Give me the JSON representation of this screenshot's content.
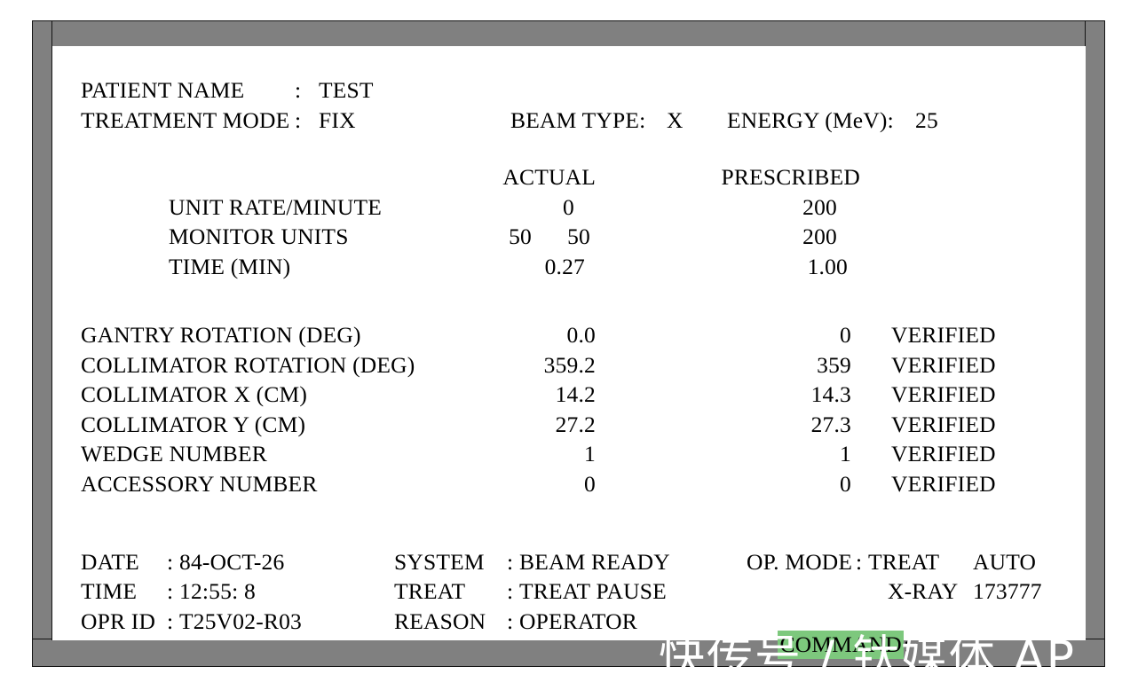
{
  "window": {
    "title_bar_label": "",
    "frame_color": "#808080",
    "frame_outline_color": "#141414",
    "screen_background": "#ffffff",
    "text_color": "#000000",
    "highlight_color": "#7dc87d"
  },
  "header": {
    "patient_name_label": "PATIENT NAME",
    "patient_name_sep": ":",
    "patient_name_value": "TEST",
    "treatment_mode_label": "TREATMENT MODE",
    "treatment_mode_sep": ":",
    "treatment_mode_value": "FIX",
    "beam_type_label": "BEAM TYPE:",
    "beam_type_value": "X",
    "energy_label": "ENERGY (MeV):",
    "energy_value": "25"
  },
  "dose_table": {
    "col_actual": "ACTUAL",
    "col_prescribed": "PRESCRIBED",
    "rows": [
      {
        "label": "UNIT RATE/MINUTE",
        "actual": "0",
        "actual2": "",
        "prescribed": "200"
      },
      {
        "label": "MONITOR UNITS",
        "actual": "50",
        "actual2": "50",
        "prescribed": "200"
      },
      {
        "label": "TIME (MIN)",
        "actual": "0.27",
        "actual2": "",
        "prescribed": "1.00"
      }
    ]
  },
  "parameter_table": {
    "rows": [
      {
        "label": "GANTRY ROTATION (DEG)",
        "actual": "0.0",
        "prescribed": "0",
        "status": "VERIFIED"
      },
      {
        "label": "COLLIMATOR ROTATION (DEG)",
        "actual": "359.2",
        "prescribed": "359",
        "status": "VERIFIED"
      },
      {
        "label": "COLLIMATOR X (CM)",
        "actual": "14.2",
        "prescribed": "14.3",
        "status": "VERIFIED"
      },
      {
        "label": "COLLIMATOR Y (CM)",
        "actual": "27.2",
        "prescribed": "27.3",
        "status": "VERIFIED"
      },
      {
        "label": "WEDGE NUMBER",
        "actual": "1",
        "prescribed": "1",
        "status": "VERIFIED"
      },
      {
        "label": "ACCESSORY NUMBER",
        "actual": "0",
        "prescribed": "0",
        "status": "VERIFIED"
      }
    ]
  },
  "status_bar": {
    "date_label": "DATE",
    "date_sep": ":",
    "date_value": "84-OCT-26",
    "time_label": "TIME",
    "time_sep": ":",
    "time_value": "12:55: 8",
    "opr_id_label": "OPR ID",
    "opr_id_sep": ":",
    "opr_id_value": "T25V02-R03",
    "system_label": "SYSTEM",
    "system_sep": ":",
    "system_value": "BEAM READY",
    "treat_label": "TREAT",
    "treat_sep": ":",
    "treat_value": "TREAT PAUSE",
    "reason_label": "REASON",
    "reason_sep": ":",
    "reason_value": "OPERATOR",
    "op_mode_label": "OP. MODE",
    "op_mode_sep": ":",
    "op_mode_value": "TREAT",
    "op_mode_aux": "AUTO",
    "beam_mode_value": "X-RAY",
    "beam_counter": "173777",
    "command_label": "COMMAND",
    "command_sep": ":",
    "command_value": ""
  },
  "watermark": {
    "text": "快传号 / 钛媒体 AP"
  }
}
